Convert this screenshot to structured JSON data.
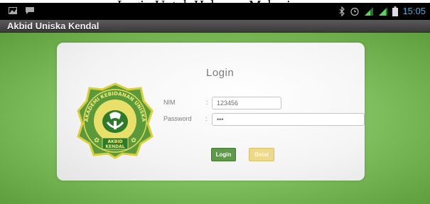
{
  "caption": "Login Untuk Halaman Mahasiswa",
  "status_bar": {
    "time": "15:05",
    "icons": [
      "image-icon",
      "message-icon",
      "bluetooth-icon",
      "alarm-icon",
      "signal-icon",
      "signal-icon",
      "battery-icon"
    ]
  },
  "action_bar": {
    "title": "Akbid Uniska Kendal"
  },
  "login_form": {
    "title": "Login",
    "nim_label": "NIM",
    "nim_colon": ":",
    "nim_value": "123456",
    "password_label": "Password",
    "password_colon": ":",
    "password_value": "•••",
    "login_button": "Login",
    "cancel_button": "Batal"
  },
  "logo": {
    "top_text": "AKADEMI KEBIDANAN UNISKA",
    "bottom_text_line1": "AKBID",
    "bottom_text_line2": "KENDAL"
  },
  "colors": {
    "background_green": "#7dbd5a",
    "login_button": "#5e9a49",
    "cancel_button": "#eed98a",
    "clock": "#3fb5e5"
  }
}
